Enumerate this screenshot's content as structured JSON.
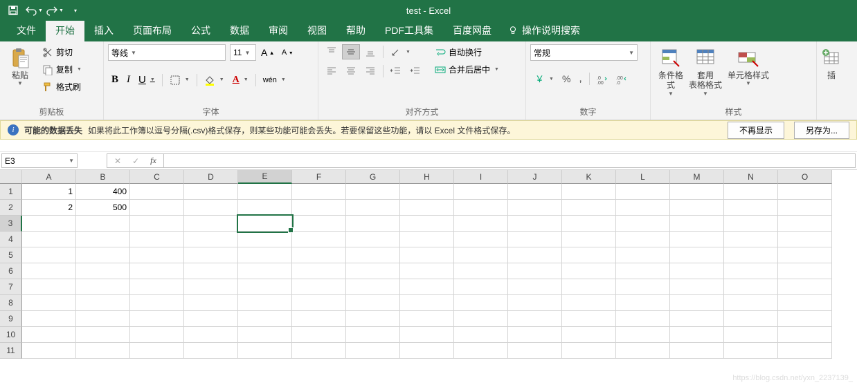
{
  "title": "test - Excel",
  "qat": {
    "save": "save",
    "undo": "undo",
    "redo": "redo",
    "more": "more"
  },
  "tabs": [
    "文件",
    "开始",
    "插入",
    "页面布局",
    "公式",
    "数据",
    "审阅",
    "视图",
    "帮助",
    "PDF工具集",
    "百度网盘"
  ],
  "active_tab_index": 1,
  "tell_me": "操作说明搜索",
  "clipboard": {
    "paste": "粘贴",
    "cut": "剪切",
    "copy": "复制",
    "format_painter": "格式刷",
    "group": "剪贴板"
  },
  "font": {
    "name": "等线",
    "size": "11",
    "group": "字体",
    "bold": "B",
    "italic": "I",
    "underline": "U"
  },
  "align": {
    "group": "对齐方式",
    "wrap": "自动换行",
    "merge": "合并后居中"
  },
  "number": {
    "format": "常规",
    "group": "数字"
  },
  "styles": {
    "cond": "条件格式",
    "table": "套用\n表格格式",
    "cell": "单元格样式",
    "group": "样式"
  },
  "insert_group": {
    "insert": "插"
  },
  "msgbar": {
    "title": "可能的数据丢失",
    "text": "如果将此工作簿以逗号分隔(.csv)格式保存，则某些功能可能会丢失。若要保留这些功能，请以 Excel 文件格式保存。",
    "dismiss": "不再显示",
    "saveas": "另存为..."
  },
  "namebox": "E3",
  "formula": "",
  "columns": [
    "A",
    "B",
    "C",
    "D",
    "E",
    "F",
    "G",
    "H",
    "I",
    "J",
    "K",
    "L",
    "M",
    "N",
    "O"
  ],
  "active_col": "E",
  "active_row": 3,
  "row_count": 11,
  "cells": {
    "1": {
      "A": "1",
      "B": "400"
    },
    "2": {
      "A": "2",
      "B": "500"
    }
  },
  "watermark": "https://blog.csdn.net/yxn_2237139_"
}
